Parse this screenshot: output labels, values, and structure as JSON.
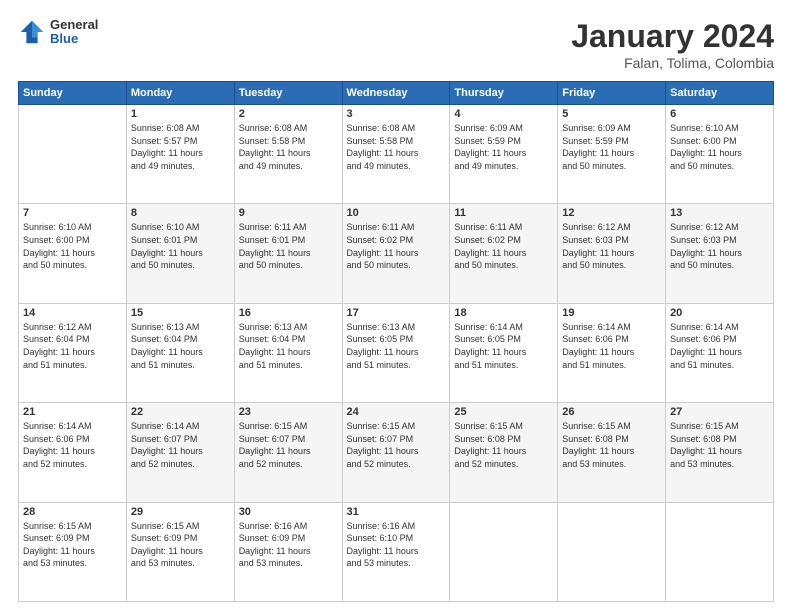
{
  "header": {
    "logo": {
      "general": "General",
      "blue": "Blue"
    },
    "title": "January 2024",
    "location": "Falan, Tolima, Colombia"
  },
  "weekdays": [
    "Sunday",
    "Monday",
    "Tuesday",
    "Wednesday",
    "Thursday",
    "Friday",
    "Saturday"
  ],
  "weeks": [
    [
      {
        "day": "",
        "info": ""
      },
      {
        "day": "1",
        "info": "Sunrise: 6:08 AM\nSunset: 5:57 PM\nDaylight: 11 hours\nand 49 minutes."
      },
      {
        "day": "2",
        "info": "Sunrise: 6:08 AM\nSunset: 5:58 PM\nDaylight: 11 hours\nand 49 minutes."
      },
      {
        "day": "3",
        "info": "Sunrise: 6:08 AM\nSunset: 5:58 PM\nDaylight: 11 hours\nand 49 minutes."
      },
      {
        "day": "4",
        "info": "Sunrise: 6:09 AM\nSunset: 5:59 PM\nDaylight: 11 hours\nand 49 minutes."
      },
      {
        "day": "5",
        "info": "Sunrise: 6:09 AM\nSunset: 5:59 PM\nDaylight: 11 hours\nand 50 minutes."
      },
      {
        "day": "6",
        "info": "Sunrise: 6:10 AM\nSunset: 6:00 PM\nDaylight: 11 hours\nand 50 minutes."
      }
    ],
    [
      {
        "day": "7",
        "info": "Sunrise: 6:10 AM\nSunset: 6:00 PM\nDaylight: 11 hours\nand 50 minutes."
      },
      {
        "day": "8",
        "info": "Sunrise: 6:10 AM\nSunset: 6:01 PM\nDaylight: 11 hours\nand 50 minutes."
      },
      {
        "day": "9",
        "info": "Sunrise: 6:11 AM\nSunset: 6:01 PM\nDaylight: 11 hours\nand 50 minutes."
      },
      {
        "day": "10",
        "info": "Sunrise: 6:11 AM\nSunset: 6:02 PM\nDaylight: 11 hours\nand 50 minutes."
      },
      {
        "day": "11",
        "info": "Sunrise: 6:11 AM\nSunset: 6:02 PM\nDaylight: 11 hours\nand 50 minutes."
      },
      {
        "day": "12",
        "info": "Sunrise: 6:12 AM\nSunset: 6:03 PM\nDaylight: 11 hours\nand 50 minutes."
      },
      {
        "day": "13",
        "info": "Sunrise: 6:12 AM\nSunset: 6:03 PM\nDaylight: 11 hours\nand 50 minutes."
      }
    ],
    [
      {
        "day": "14",
        "info": "Sunrise: 6:12 AM\nSunset: 6:04 PM\nDaylight: 11 hours\nand 51 minutes."
      },
      {
        "day": "15",
        "info": "Sunrise: 6:13 AM\nSunset: 6:04 PM\nDaylight: 11 hours\nand 51 minutes."
      },
      {
        "day": "16",
        "info": "Sunrise: 6:13 AM\nSunset: 6:04 PM\nDaylight: 11 hours\nand 51 minutes."
      },
      {
        "day": "17",
        "info": "Sunrise: 6:13 AM\nSunset: 6:05 PM\nDaylight: 11 hours\nand 51 minutes."
      },
      {
        "day": "18",
        "info": "Sunrise: 6:14 AM\nSunset: 6:05 PM\nDaylight: 11 hours\nand 51 minutes."
      },
      {
        "day": "19",
        "info": "Sunrise: 6:14 AM\nSunset: 6:06 PM\nDaylight: 11 hours\nand 51 minutes."
      },
      {
        "day": "20",
        "info": "Sunrise: 6:14 AM\nSunset: 6:06 PM\nDaylight: 11 hours\nand 51 minutes."
      }
    ],
    [
      {
        "day": "21",
        "info": "Sunrise: 6:14 AM\nSunset: 6:06 PM\nDaylight: 11 hours\nand 52 minutes."
      },
      {
        "day": "22",
        "info": "Sunrise: 6:14 AM\nSunset: 6:07 PM\nDaylight: 11 hours\nand 52 minutes."
      },
      {
        "day": "23",
        "info": "Sunrise: 6:15 AM\nSunset: 6:07 PM\nDaylight: 11 hours\nand 52 minutes."
      },
      {
        "day": "24",
        "info": "Sunrise: 6:15 AM\nSunset: 6:07 PM\nDaylight: 11 hours\nand 52 minutes."
      },
      {
        "day": "25",
        "info": "Sunrise: 6:15 AM\nSunset: 6:08 PM\nDaylight: 11 hours\nand 52 minutes."
      },
      {
        "day": "26",
        "info": "Sunrise: 6:15 AM\nSunset: 6:08 PM\nDaylight: 11 hours\nand 53 minutes."
      },
      {
        "day": "27",
        "info": "Sunrise: 6:15 AM\nSunset: 6:08 PM\nDaylight: 11 hours\nand 53 minutes."
      }
    ],
    [
      {
        "day": "28",
        "info": "Sunrise: 6:15 AM\nSunset: 6:09 PM\nDaylight: 11 hours\nand 53 minutes."
      },
      {
        "day": "29",
        "info": "Sunrise: 6:15 AM\nSunset: 6:09 PM\nDaylight: 11 hours\nand 53 minutes."
      },
      {
        "day": "30",
        "info": "Sunrise: 6:16 AM\nSunset: 6:09 PM\nDaylight: 11 hours\nand 53 minutes."
      },
      {
        "day": "31",
        "info": "Sunrise: 6:16 AM\nSunset: 6:10 PM\nDaylight: 11 hours\nand 53 minutes."
      },
      {
        "day": "",
        "info": ""
      },
      {
        "day": "",
        "info": ""
      },
      {
        "day": "",
        "info": ""
      }
    ]
  ]
}
